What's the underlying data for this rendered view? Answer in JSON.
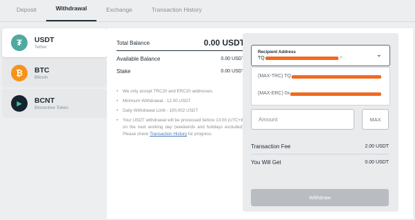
{
  "tabs": [
    "Deposit",
    "Withdrawal",
    "Exchange",
    "Transaction History"
  ],
  "active_tab": "Withdrawal",
  "coins": [
    {
      "symbol": "USDT",
      "name": "Tether",
      "icon": "tether-icon",
      "color": "#50a9a0",
      "glyph": "₮"
    },
    {
      "symbol": "BTC",
      "name": "Bitcoin",
      "icon": "bitcoin-icon",
      "color": "#f7931a",
      "glyph": "₿"
    },
    {
      "symbol": "BCNT",
      "name": "Bincentive Token",
      "icon": "bcnt-icon",
      "color": "#15242e",
      "glyph": "▶"
    }
  ],
  "balances": {
    "total_label": "Total Balance",
    "total_value": "0.00 USDT",
    "available_label": "Available Balance",
    "available_value": "0.00 USDT",
    "stake_label": "Stake",
    "stake_value": "0.00 USDT"
  },
  "notes": {
    "n1": "We only accept TRC20 and ERC20 addresses.",
    "n2": "Minimum Withdrawal - 12.00 USDT",
    "n3": "Daily Withdrawal Limit - 100,002 USDT",
    "n4_pre": "Your USDT withdrawal will be processed before 13:00 (UTC+8) on the next working day (weekends and holidays excluded). Please check ",
    "n4_link": "Transaction History",
    "n4_post": " for progress."
  },
  "form": {
    "address_label": "Recipient Address",
    "address_value": "TQ",
    "address_suffix": "F",
    "option_trc": "(MAX-TRC) TQ",
    "option_erc": "(MAX-ERC) 0x",
    "amount_placeholder": "Amount",
    "max_label": "MAX",
    "fee_label": "Transaction Fee",
    "fee_value": "2.00 USDT",
    "get_label": "You Will Get",
    "get_value": "0.00 USDT",
    "withdraw_label": "Withdraw"
  },
  "colors": {
    "accent": "#1f2a33",
    "redaction": "#f06a20",
    "link": "#4a7ab8"
  }
}
